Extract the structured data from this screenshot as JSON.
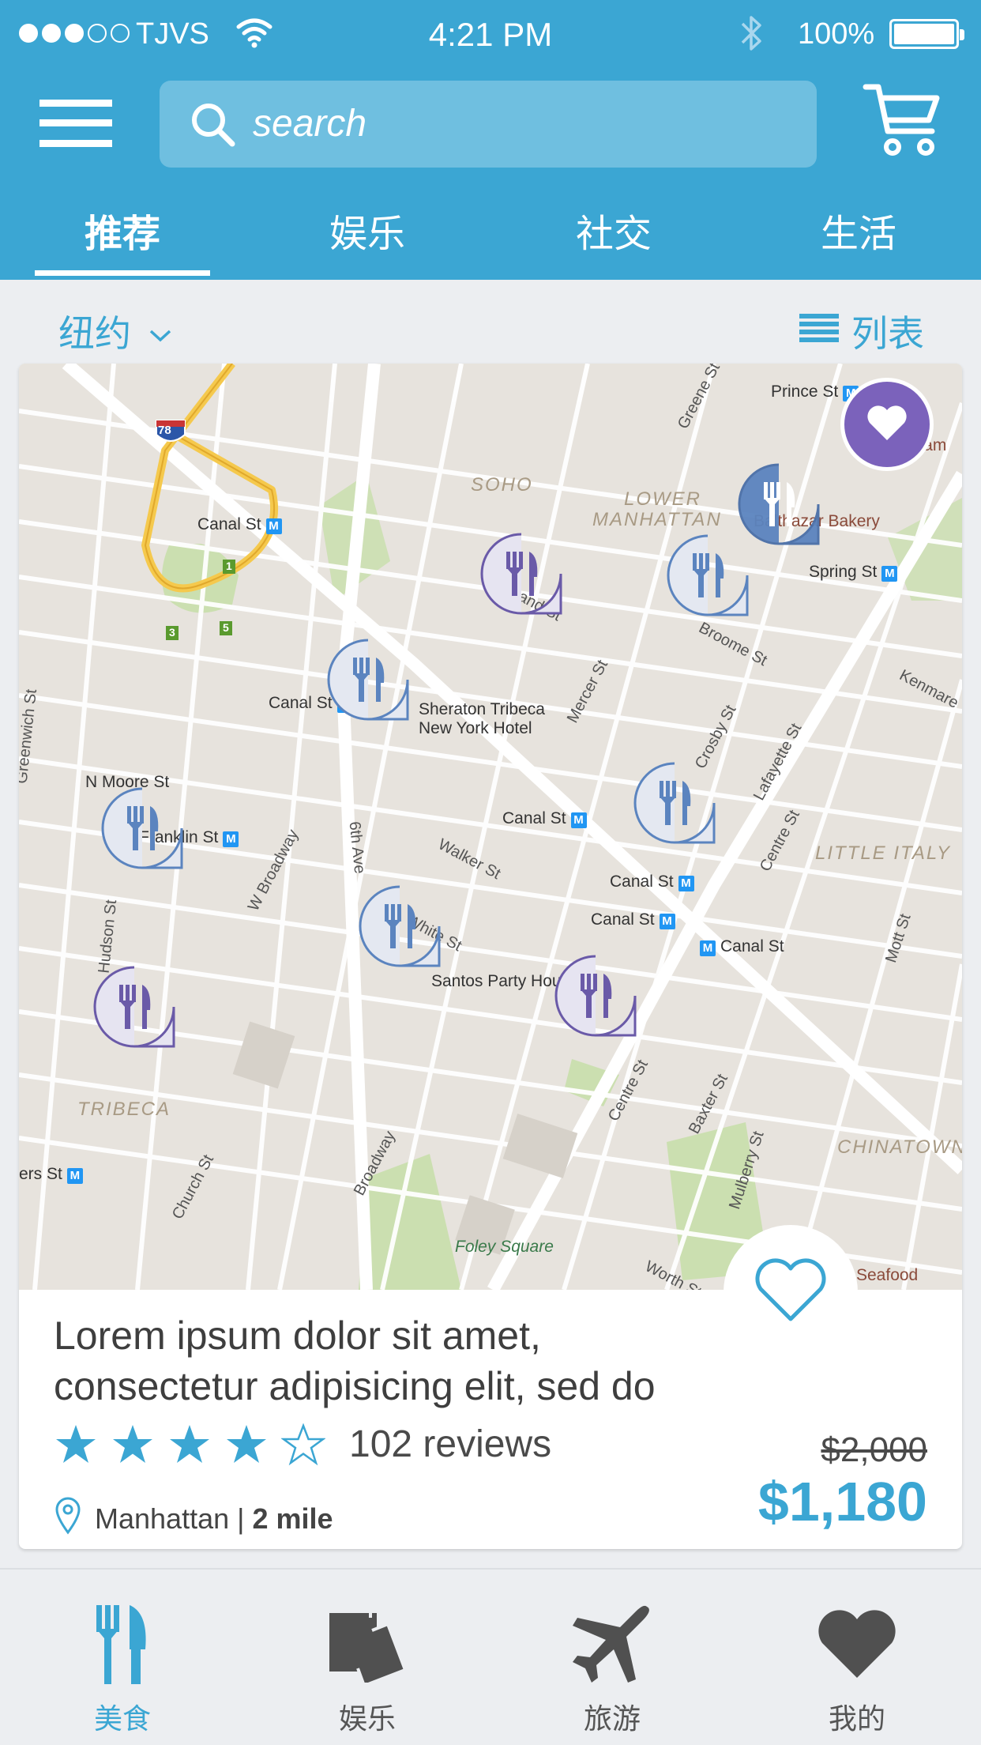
{
  "status_bar": {
    "carrier": "TJVS",
    "time": "4:21 PM",
    "battery": "100%",
    "signal_bars": 3,
    "signal_total": 5
  },
  "header": {
    "search_placeholder": "search",
    "tabs": [
      {
        "label": "推荐",
        "active": true
      },
      {
        "label": "娱乐",
        "active": false
      },
      {
        "label": "社交",
        "active": false
      },
      {
        "label": "生活",
        "active": false
      }
    ]
  },
  "filters": {
    "city": "纽约",
    "list_view_label": "列表"
  },
  "map": {
    "labels": {
      "prince_st": "Prince St",
      "soho": "SOHO",
      "lower_manhattan_1": "LOWER",
      "lower_manhattan_2": "MANHATTAN",
      "balthazar": "Balthazar Bakery",
      "spring_st": "Spring St",
      "canal_st_1": "Canal St",
      "canal_st_2": "Canal St",
      "canal_st_3": "Canal St",
      "canal_st_4": "Canal St",
      "canal_st_5": "Canal St",
      "canal_st_6": "Canal St",
      "sheraton_1": "Sheraton Tribeca",
      "sheraton_2": "New York Hotel",
      "n_moore": "N Moore St",
      "franklin": "Franklin St",
      "little_italy": "LITTLE ITALY",
      "tribeca": "TRIBECA",
      "chinatown": "CHINATOWN",
      "santos": "Santos Party House",
      "foley": "Foley Square",
      "seafood": "Seafood",
      "chambers": "ers St",
      "walker": "Walker St",
      "white": "White St",
      "greene": "Greene St",
      "mercer": "Mercer St",
      "crosby": "Crosby St",
      "lafayette": "Lafayette St",
      "centre_1": "Centre St",
      "centre_2": "Centre St",
      "broome": "Broome St",
      "grand": "Grand St",
      "kenmare": "Kenmare",
      "sixth_ave": "6th Ave",
      "w_broadway": "W Broadway",
      "hudson": "Hudson St",
      "greenwich": "Greenwich St",
      "church": "Church St",
      "broadway": "Broadway",
      "baxter": "Baxter St",
      "mulberry": "Mulberry St",
      "mott": "Mott St",
      "worth": "Worth St",
      "ham": "Ham",
      "i78": "78",
      "exit_1": "1",
      "exit_3": "3",
      "exit_5": "5"
    }
  },
  "listing": {
    "title_line1": "Lorem ipsum dolor sit amet,",
    "title_line2": "consectetur adipisicing elit, sed do",
    "rating": 4,
    "rating_max": 5,
    "reviews": "102 reviews",
    "original_price": "$2,000",
    "price": "$1,180",
    "location": "Manhattan",
    "separator": " | ",
    "distance": "2 mile"
  },
  "bottom_nav": [
    {
      "label": "美食",
      "icon": "fork-knife-icon",
      "active": true
    },
    {
      "label": "娱乐",
      "icon": "ticket-icon",
      "active": false
    },
    {
      "label": "旅游",
      "icon": "airplane-icon",
      "active": false
    },
    {
      "label": "我的",
      "icon": "heart-icon",
      "active": false
    }
  ],
  "colors": {
    "primary": "#3ba6d3",
    "pin_purple": "#6a5aa8",
    "pin_blue": "#5b84bf",
    "fav_purple": "#7b62bb"
  }
}
